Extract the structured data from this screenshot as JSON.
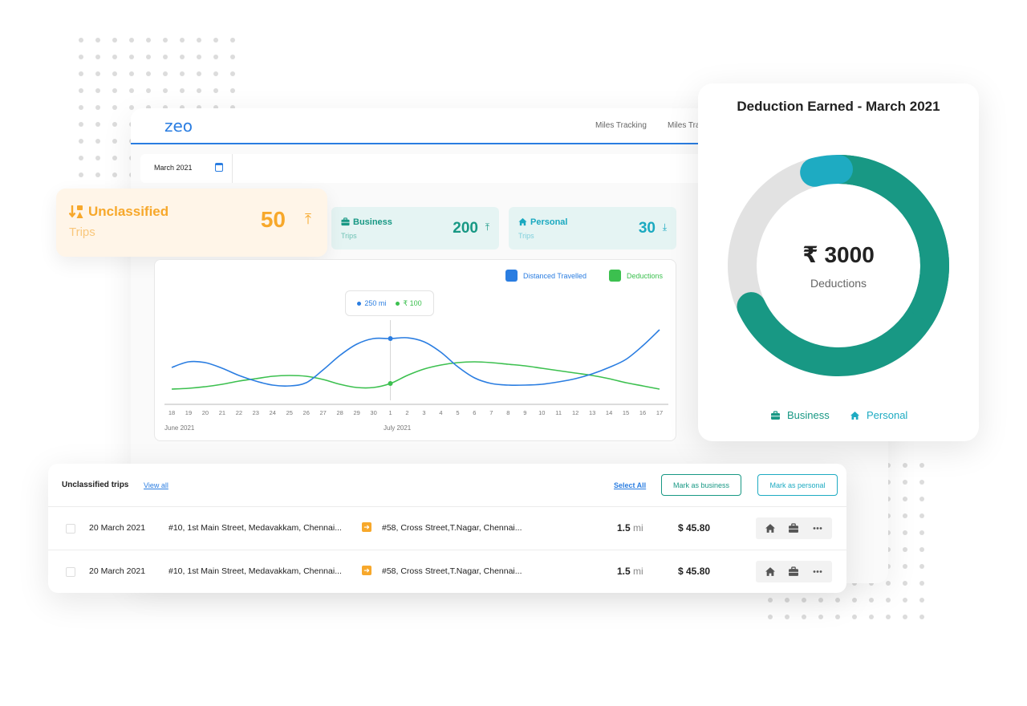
{
  "app": {
    "logo": "zeo",
    "nav": [
      "Miles Tracking",
      "Miles Tracking"
    ],
    "date_filter": "March 2021",
    "accent": "#2a7de1"
  },
  "stats": {
    "unclassified": {
      "label": "Unclassified",
      "sub": "Trips",
      "value": "50",
      "trend": "up",
      "color": "#f7a82b"
    },
    "business": {
      "label": "Business",
      "sub": "Trips",
      "value": "200",
      "trend": "up",
      "color": "#189884"
    },
    "personal": {
      "label": "Personal",
      "sub": "Trips",
      "value": "30",
      "trend": "down",
      "color": "#1aa9c0"
    }
  },
  "chart_data": {
    "type": "line",
    "title": "",
    "xlabel": "",
    "ylabel": "",
    "x": [
      "18",
      "19",
      "20",
      "21",
      "22",
      "23",
      "24",
      "25",
      "26",
      "27",
      "28",
      "29",
      "30",
      "1",
      "2",
      "3",
      "4",
      "5",
      "6",
      "7",
      "8",
      "9",
      "10",
      "11",
      "12",
      "13",
      "14",
      "15",
      "16",
      "17"
    ],
    "x_groups": [
      {
        "label": "June 2021",
        "start_index": 0
      },
      {
        "label": "July 2021",
        "start_index": 13
      }
    ],
    "series": [
      {
        "name": "Distanced Travelled",
        "color": "#2a7de1",
        "values": [
          46,
          53,
          52,
          45,
          36,
          29,
          24,
          23,
          27,
          43,
          61,
          75,
          82,
          82,
          83,
          78,
          65,
          47,
          33,
          26,
          24,
          24,
          25,
          28,
          32,
          38,
          46,
          56,
          73,
          93
        ]
      },
      {
        "name": "Deductions",
        "color": "#3cc04f",
        "values": [
          19,
          20,
          22,
          25,
          29,
          32,
          35,
          36,
          35,
          31,
          25,
          21,
          21,
          26,
          36,
          44,
          49,
          52,
          53,
          52,
          50,
          48,
          45,
          42,
          39,
          36,
          32,
          27,
          23,
          19
        ]
      }
    ],
    "ylim": [
      0,
      100
    ],
    "grid": false,
    "legend": "top-right",
    "y_axis_labels": false,
    "tooltip": {
      "index": 13,
      "distance": "250 mi",
      "deduction": "₹ 100"
    }
  },
  "deduction": {
    "title": "Deduction Earned - March 2021",
    "amount": "₹ 3000",
    "label": "Deductions",
    "donut": {
      "type": "pie",
      "segments": [
        {
          "name": "Business",
          "fraction": 0.68,
          "color": "#189884"
        },
        {
          "name": "Personal",
          "fraction": 0.04,
          "color": "#1eabc2"
        },
        {
          "name": "Remaining",
          "fraction": 0.28,
          "color": "#e2e2e2"
        }
      ]
    },
    "legend": [
      {
        "name": "Business",
        "color": "#189884"
      },
      {
        "name": "Personal",
        "color": "#1eabc2"
      }
    ]
  },
  "trips": {
    "title": "Unclassified trips",
    "view_all": "View all",
    "select_all": "Select All",
    "mark_business": "Mark as business",
    "mark_personal": "Mark as personal",
    "rows": [
      {
        "date": "20 March 2021",
        "from": "#10, 1st Main Street, Medavakkam, Chennai...",
        "to": "#58, Cross Street,T.Nagar, Chennai...",
        "distance": "1.5",
        "unit": "mi",
        "amount": "$ 45.80"
      },
      {
        "date": "20 March 2021",
        "from": "#10, 1st Main Street, Medavakkam, Chennai...",
        "to": "#58, Cross Street,T.Nagar, Chennai...",
        "distance": "1.5",
        "unit": "mi",
        "amount": "$ 45.80"
      }
    ]
  }
}
